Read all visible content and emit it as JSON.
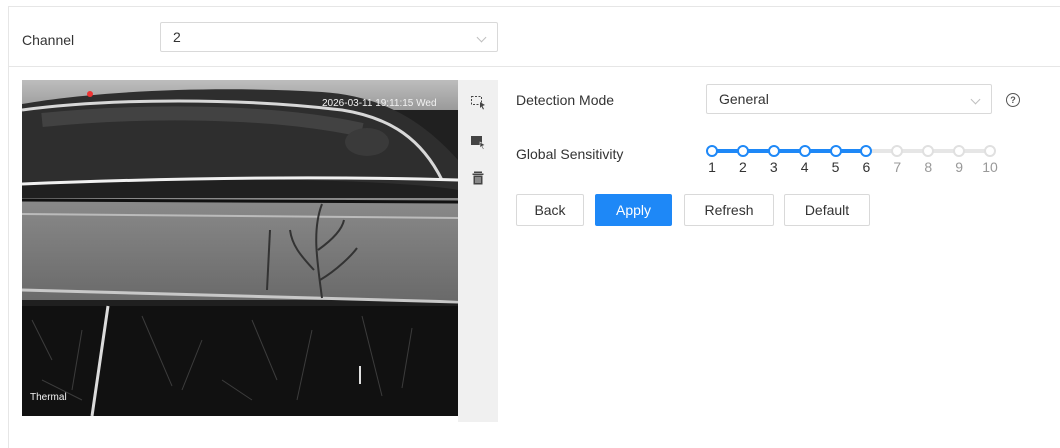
{
  "channel": {
    "label": "Channel",
    "value": "2"
  },
  "video": {
    "timestamp": "2026-03-11 19:11:15 Wed",
    "overlay_label": "Thermal",
    "tools": [
      "draw-region-icon",
      "draw-filled-region-icon",
      "trash-icon"
    ]
  },
  "detection_mode": {
    "label": "Detection Mode",
    "value": "General"
  },
  "sensitivity": {
    "label": "Global Sensitivity",
    "ticks": [
      "1",
      "2",
      "3",
      "4",
      "5",
      "6",
      "7",
      "8",
      "9",
      "10"
    ],
    "value": 6,
    "max": 10
  },
  "buttons": {
    "back": "Back",
    "apply": "Apply",
    "refresh": "Refresh",
    "default": "Default"
  },
  "colors": {
    "accent": "#1e88f7",
    "border": "#d9d9d9",
    "toolstrip": "#f0f0f0"
  }
}
